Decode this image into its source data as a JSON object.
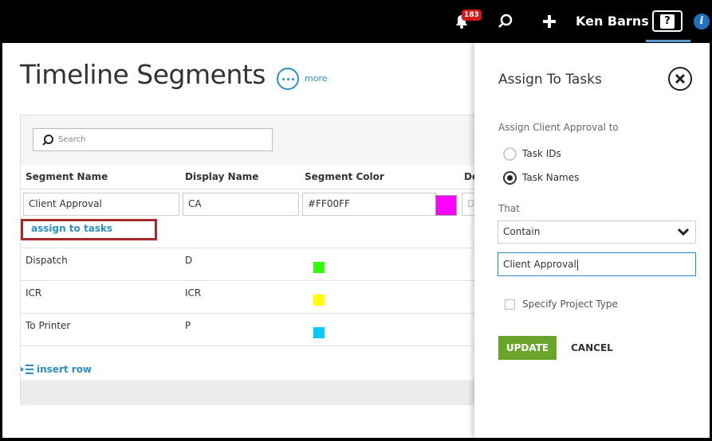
{
  "topbar": {
    "notification_count": "183",
    "user_name": "Ken Barns",
    "help_label": "?",
    "info_label": "i"
  },
  "page": {
    "title": "Timeline Segments",
    "more_label": "more"
  },
  "search": {
    "placeholder": "Search"
  },
  "table": {
    "columns": [
      "Segment Name",
      "Display Name",
      "Segment Color",
      "De"
    ],
    "edit_row": {
      "segment_name": "Client Approval",
      "display_name": "CA",
      "segment_color": "#FF00FF",
      "description_placeholder": "De",
      "swatch_color": "#FF00FF"
    },
    "assign_link": "assign to tasks",
    "rows": [
      {
        "name": "Dispatch",
        "display": "D",
        "color": "#33FF00"
      },
      {
        "name": "ICR",
        "display": "ICR",
        "color": "#FFFF00"
      },
      {
        "name": "To Printer",
        "display": "P",
        "color": "#00CCFF"
      }
    ],
    "insert_row_label": "insert row"
  },
  "panel": {
    "title": "Assign To Tasks",
    "assign_label": "Assign Client Approval to",
    "radio_options": [
      {
        "label": "Task IDs",
        "checked": false
      },
      {
        "label": "Task Names",
        "checked": true
      }
    ],
    "that_label": "That",
    "select_value": "Contain",
    "text_value": "Client Approval",
    "checkbox_label": "Specify Project Type",
    "update_label": "UPDATE",
    "cancel_label": "CANCEL"
  }
}
